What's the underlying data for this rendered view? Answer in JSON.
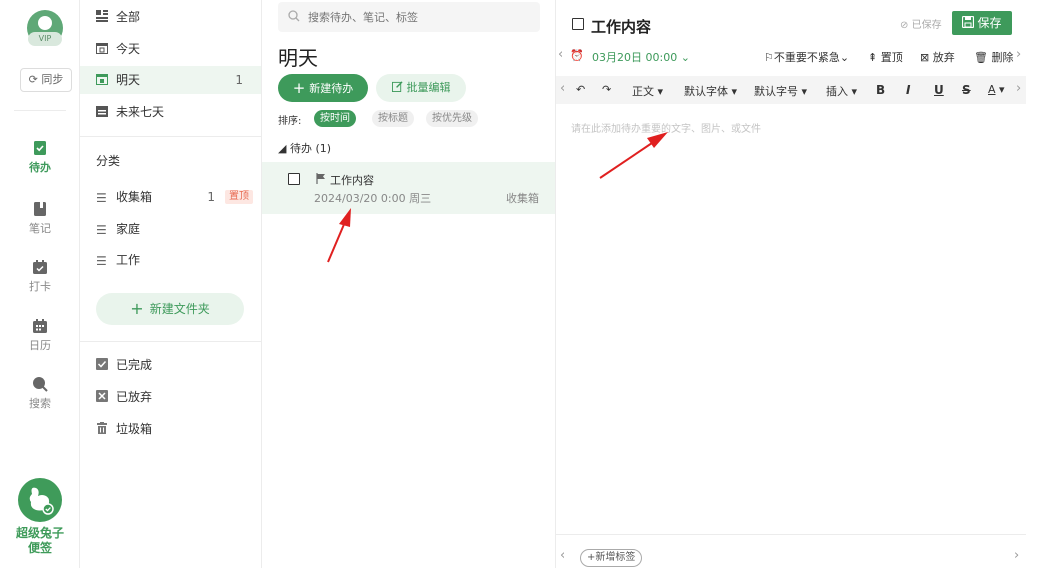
{
  "rail": {
    "vip": "VIP",
    "sync": "同步",
    "items": [
      {
        "label": "待办",
        "icon": "todo-icon"
      },
      {
        "label": "笔记",
        "icon": "note-icon"
      },
      {
        "label": "打卡",
        "icon": "checkin-icon"
      },
      {
        "label": "日历",
        "icon": "calendar-icon"
      },
      {
        "label": "搜索",
        "icon": "search-icon"
      }
    ],
    "brand_line1": "超级兔子",
    "brand_line2": "便签"
  },
  "nav": {
    "views": [
      {
        "label": "全部"
      },
      {
        "label": "今天"
      },
      {
        "label": "明天",
        "count": "1"
      },
      {
        "label": "未来七天"
      }
    ],
    "category_title": "分类",
    "folders": [
      {
        "label": "收集箱",
        "count": "1",
        "badge": "置顶"
      },
      {
        "label": "家庭"
      },
      {
        "label": "工作"
      }
    ],
    "new_folder": "新建文件夹",
    "bottom": [
      {
        "label": "已完成"
      },
      {
        "label": "已放弃"
      },
      {
        "label": "垃圾箱"
      }
    ]
  },
  "list": {
    "search_placeholder": "搜索待办、笔记、标签",
    "title": "明天",
    "new_todo": "新建待办",
    "batch_edit": "批量编辑",
    "sort_label": "排序:",
    "sort_options": [
      "按时间",
      "按标题",
      "按优先级"
    ],
    "group_label": "◢ 待办 (1)",
    "todo": {
      "title": "工作内容",
      "date": "2024/03/20 0:00 周三",
      "folder": "收集箱"
    }
  },
  "detail": {
    "title": "工作内容",
    "saved": "已保存",
    "save": "保存",
    "date": "03月20日 00:00",
    "priority": "不重要不紧急",
    "pin": "置顶",
    "abandon": "放弃",
    "delete": "删除",
    "toolbar": {
      "paragraph": "正文",
      "font": "默认字体",
      "size": "默认字号",
      "insert": "插入",
      "bold": "B",
      "italic": "I",
      "underline": "U",
      "strike": "S",
      "color": "A"
    },
    "placeholder": "请在此添加待办重要的文字、图片、或文件",
    "new_tag": "+新增标签"
  },
  "colors": {
    "accent": "#3e9a5b",
    "accent_light": "#e9f4ec",
    "badge": "#e86a51",
    "annotation": "#e02020"
  }
}
